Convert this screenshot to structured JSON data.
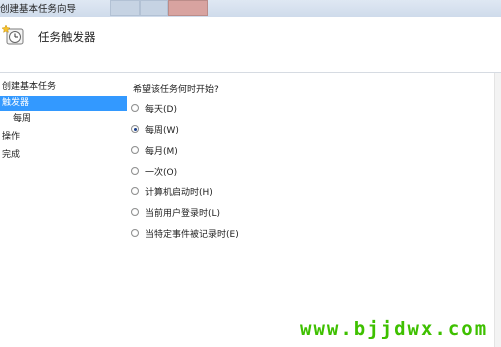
{
  "window": {
    "title": "创建基本任务向导"
  },
  "header": {
    "icon": "task-wizard-icon",
    "title": "任务触发器"
  },
  "sidebar": {
    "items": [
      {
        "label": "创建基本任务",
        "selected": false
      },
      {
        "label": "触发器",
        "selected": true
      },
      {
        "label": "每周",
        "selected": false
      },
      {
        "label": "操作",
        "selected": false
      },
      {
        "label": "完成",
        "selected": false
      }
    ]
  },
  "main": {
    "prompt": "希望该任务何时开始?",
    "options": [
      {
        "label": "每天(D)",
        "checked": false
      },
      {
        "label": "每周(W)",
        "checked": true
      },
      {
        "label": "每月(M)",
        "checked": false
      },
      {
        "label": "一次(O)",
        "checked": false
      },
      {
        "label": "计算机启动时(H)",
        "checked": false
      },
      {
        "label": "当前用户登录时(L)",
        "checked": false
      },
      {
        "label": "当特定事件被记录时(E)",
        "checked": false
      }
    ]
  },
  "watermark": {
    "text": "www.bjjdwx.com",
    "color": "#3ec000"
  },
  "colors": {
    "selection": "#3399ff",
    "titlebar": "#dfe8f3"
  }
}
